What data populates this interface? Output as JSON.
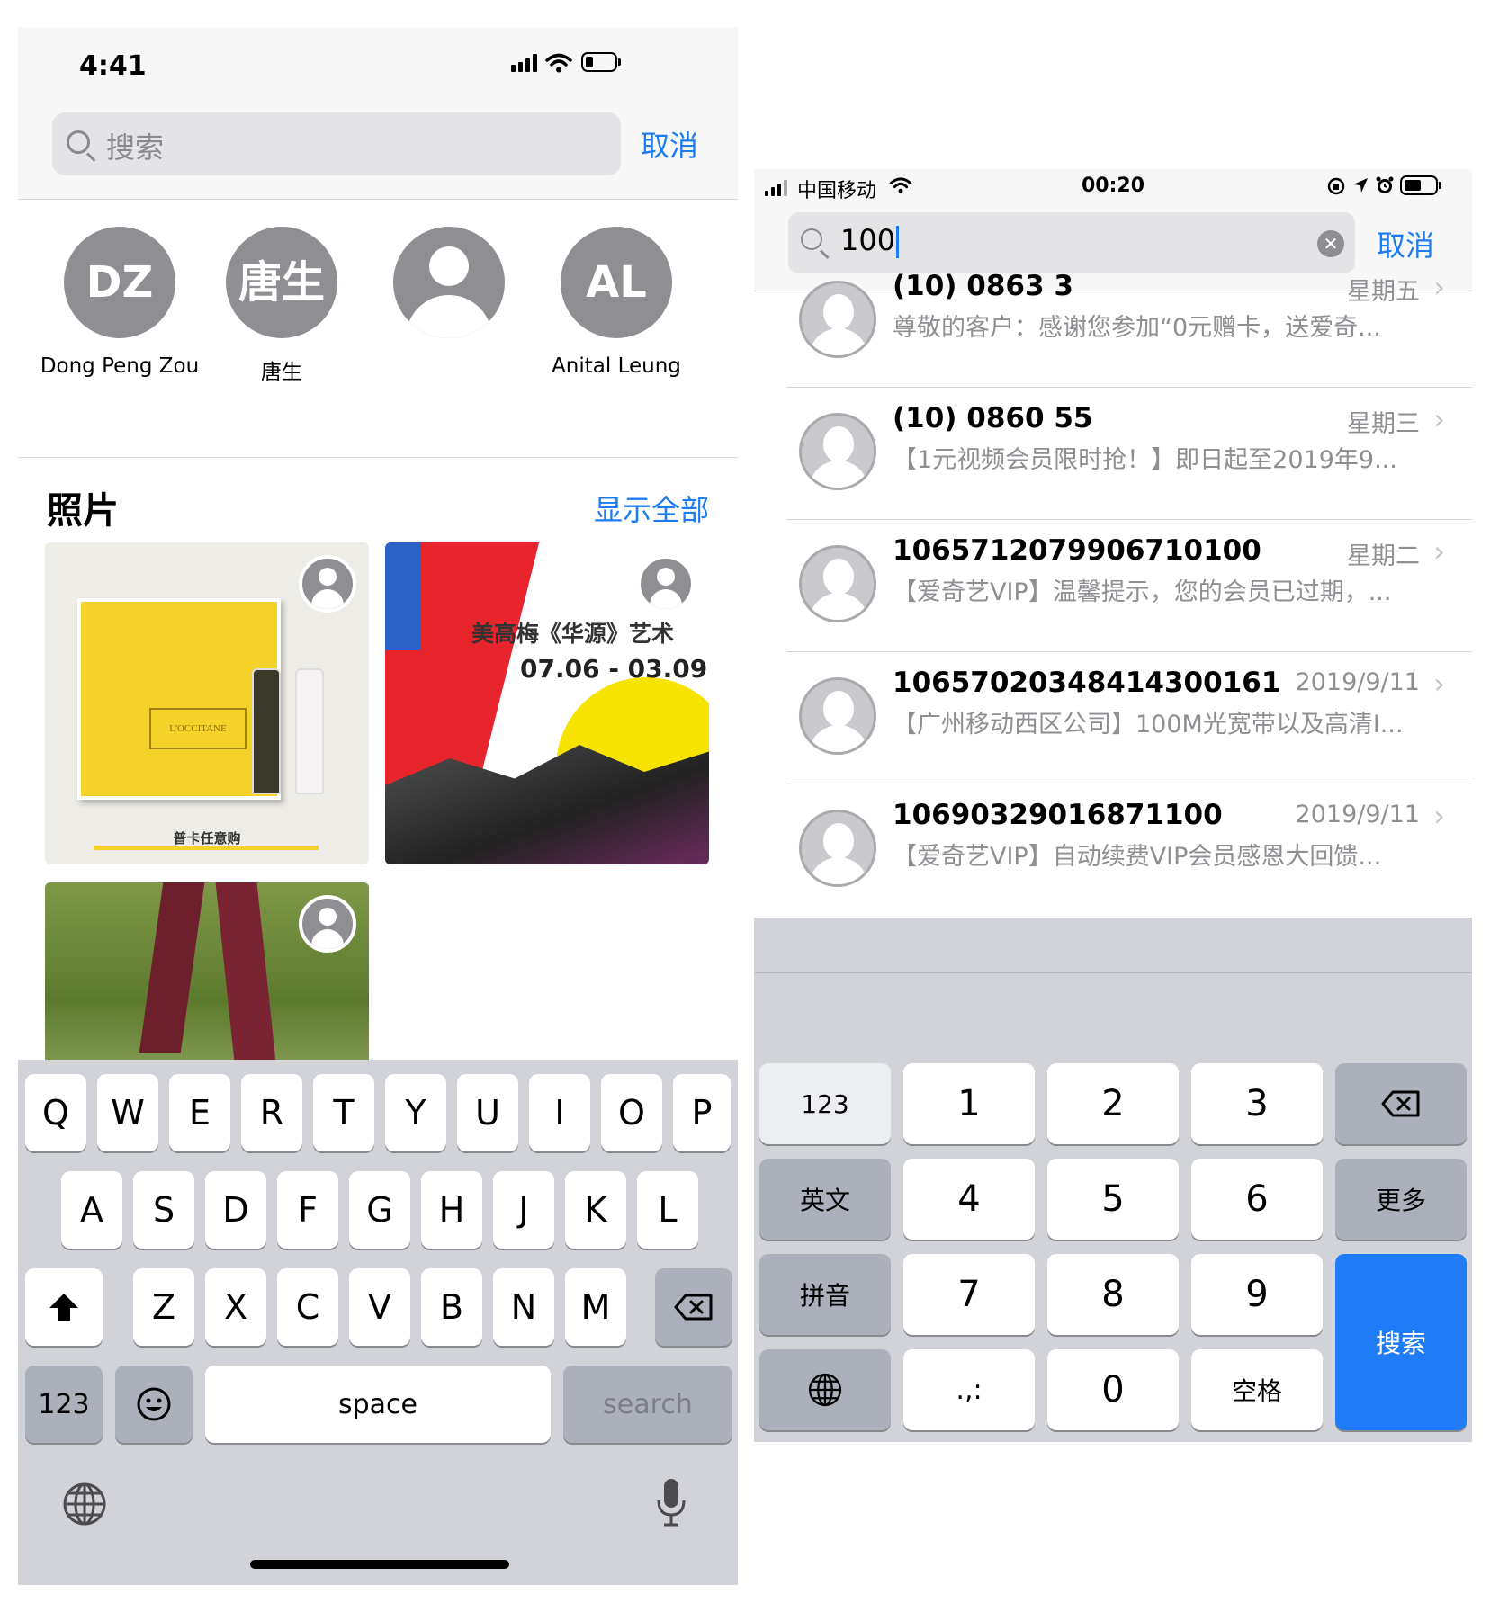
{
  "left": {
    "status": {
      "time": "4:41"
    },
    "search": {
      "placeholder": "搜索",
      "cancel": "取消"
    },
    "contacts": [
      {
        "initials": "DZ",
        "name": "Dong Peng Zou"
      },
      {
        "initials": "唐生",
        "name": "唐生"
      },
      {
        "initials": "",
        "name": ""
      },
      {
        "initials": "AL",
        "name": "Anital Leung"
      }
    ],
    "photos": {
      "title": "照片",
      "show_all": "显示全部",
      "photo1": {
        "brand": "L'OCCITANE",
        "caption": "普卡任意购"
      },
      "photo2": {
        "line1": "美高梅《华源》艺术",
        "line2": "07.06 - 03.09"
      }
    },
    "keyboard": {
      "row1": [
        "Q",
        "W",
        "E",
        "R",
        "T",
        "Y",
        "U",
        "I",
        "O",
        "P"
      ],
      "row2": [
        "A",
        "S",
        "D",
        "F",
        "G",
        "H",
        "J",
        "K",
        "L"
      ],
      "row3": [
        "Z",
        "X",
        "C",
        "V",
        "B",
        "N",
        "M"
      ],
      "num": "123",
      "space": "space",
      "search": "search"
    }
  },
  "right": {
    "status": {
      "carrier": "中国移动",
      "time": "00:20"
    },
    "search": {
      "query": "100",
      "cancel": "取消"
    },
    "messages": [
      {
        "sender": "(10) 0863 3",
        "date": "星期五",
        "preview": "尊敬的客户：感谢您参加“0元赠卡，送爱奇..."
      },
      {
        "sender": "(10) 0860 55",
        "date": "星期三",
        "preview": "【1元视频会员限时抢！】即日起至2019年9..."
      },
      {
        "sender": "1065712079906710100",
        "date": "星期二",
        "preview": "【爱奇艺VIP】温馨提示，您的会员已过期，..."
      },
      {
        "sender": "10657020348414300161",
        "date": "2019/9/11",
        "preview": "【广州移动西区公司】100M光宽带以及高清I..."
      },
      {
        "sender": "1069032901687110​0",
        "date": "2019/9/11",
        "preview": "【爱奇艺VIP】自动续费VIP会员感恩大回馈..."
      }
    ],
    "keyboard": {
      "side_left": [
        "123",
        "英文",
        "拼音",
        ""
      ],
      "digits": [
        "1",
        "2",
        "3",
        "4",
        "5",
        "6",
        "7",
        "8",
        "9"
      ],
      "punct": ".,:",
      "zero": "0",
      "space": "空格",
      "more": "更多",
      "search": "搜索"
    }
  }
}
